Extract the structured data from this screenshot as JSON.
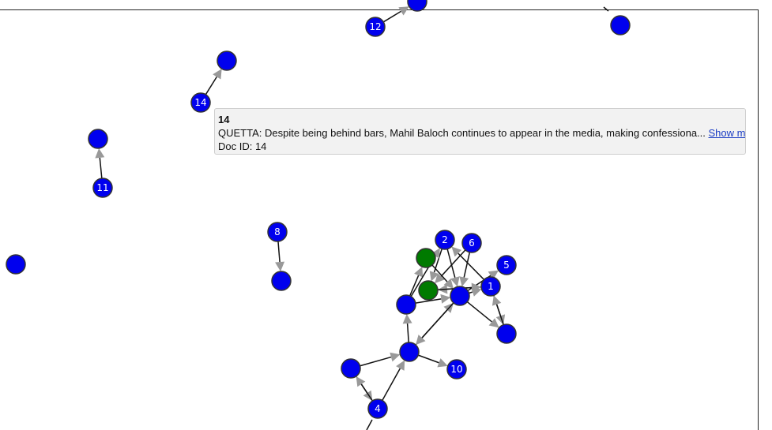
{
  "graph": {
    "colors": {
      "node_default": "#0000ee",
      "node_highlight": "#007a00",
      "node_stroke": "#333333",
      "edge": "#111111",
      "arrow": "#999999"
    },
    "nodes": [
      {
        "id": "n12",
        "label": "12",
        "color": "blue"
      },
      {
        "id": "ntop",
        "label": "",
        "color": "blue"
      },
      {
        "id": "ntr",
        "label": "",
        "color": "blue"
      },
      {
        "id": "n14",
        "label": "14",
        "color": "blue"
      },
      {
        "id": "n14t",
        "label": "",
        "color": "blue"
      },
      {
        "id": "n11",
        "label": "11",
        "color": "blue"
      },
      {
        "id": "n11t",
        "label": "",
        "color": "blue"
      },
      {
        "id": "nleft",
        "label": "",
        "color": "blue"
      },
      {
        "id": "n8",
        "label": "8",
        "color": "blue"
      },
      {
        "id": "n8t",
        "label": "",
        "color": "blue"
      },
      {
        "id": "n2",
        "label": "2",
        "color": "blue"
      },
      {
        "id": "n6",
        "label": "6",
        "color": "blue"
      },
      {
        "id": "n5",
        "label": "5",
        "color": "blue"
      },
      {
        "id": "g1",
        "label": "",
        "color": "green"
      },
      {
        "id": "g2",
        "label": "",
        "color": "green"
      },
      {
        "id": "n1",
        "label": "1",
        "color": "blue"
      },
      {
        "id": "hub",
        "label": "",
        "color": "blue"
      },
      {
        "id": "nlft",
        "label": "",
        "color": "blue"
      },
      {
        "id": "nrb",
        "label": "",
        "color": "blue"
      },
      {
        "id": "mid",
        "label": "",
        "color": "blue"
      },
      {
        "id": "n10",
        "label": "10",
        "color": "blue"
      },
      {
        "id": "nl2",
        "label": "",
        "color": "blue"
      },
      {
        "id": "n4",
        "label": "4",
        "color": "blue"
      }
    ],
    "edges": [
      [
        "n12",
        "ntop"
      ],
      [
        "n14",
        "n14t"
      ],
      [
        "n11",
        "n11t"
      ],
      [
        "n8",
        "n8t"
      ],
      [
        "n2",
        "hub"
      ],
      [
        "n2",
        "g2"
      ],
      [
        "n6",
        "g2"
      ],
      [
        "n6",
        "hub"
      ],
      [
        "hub",
        "n5"
      ],
      [
        "hub",
        "n1"
      ],
      [
        "n1",
        "n2"
      ],
      [
        "n1",
        "g2"
      ],
      [
        "n1",
        "nrb"
      ],
      [
        "nrb",
        "n1"
      ],
      [
        "hub",
        "nrb"
      ],
      [
        "g1",
        "hub"
      ],
      [
        "nlft",
        "g1"
      ],
      [
        "nlft",
        "hub"
      ],
      [
        "g2",
        "n1"
      ],
      [
        "nlft",
        "n2"
      ],
      [
        "mid",
        "nlft"
      ],
      [
        "mid",
        "hub"
      ],
      [
        "hub",
        "mid"
      ],
      [
        "mid",
        "n10"
      ],
      [
        "nl2",
        "mid"
      ],
      [
        "nl2",
        "n4"
      ],
      [
        "n4",
        "nl2"
      ],
      [
        "n4",
        "mid"
      ]
    ]
  },
  "tooltip": {
    "title": "14",
    "text": "QUETTA: Despite being behind bars, Mahil Baloch continues to appear in the media, making confessiona...",
    "show_more": "Show more",
    "doc_id": "Doc ID: 14"
  }
}
